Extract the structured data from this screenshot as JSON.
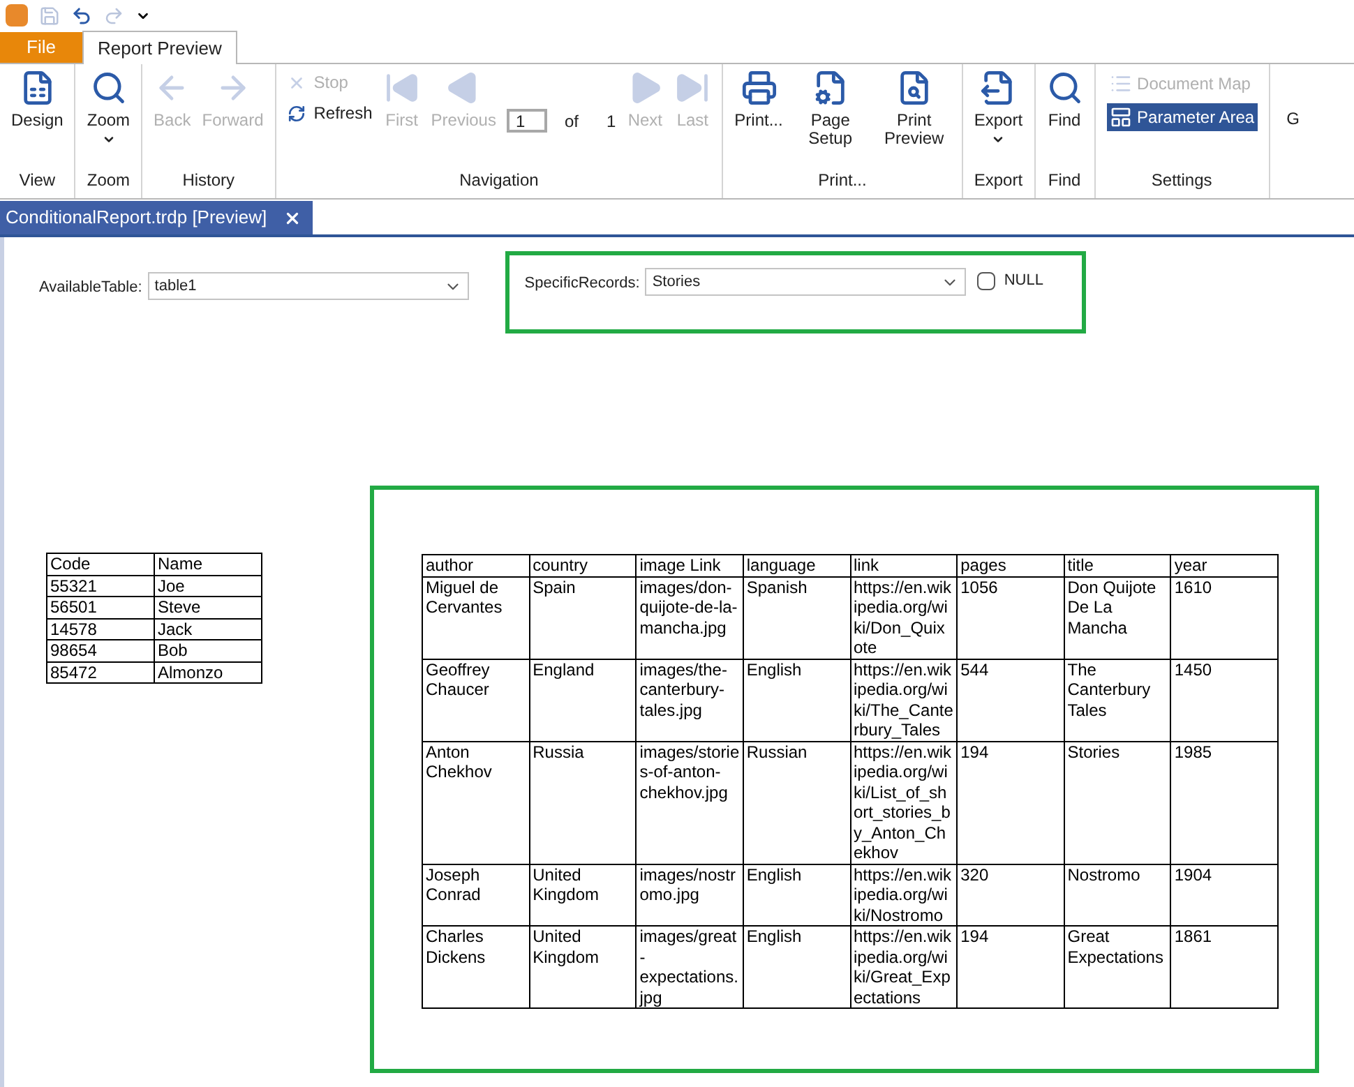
{
  "ribbon_tabs": [
    {
      "label": "File",
      "kind": "file",
      "selected": false
    },
    {
      "label": "Report Preview",
      "kind": "tab",
      "selected": true
    }
  ],
  "ribbon": {
    "groups": [
      {
        "label": "View",
        "items": [
          {
            "kind": "large",
            "label": "Design",
            "disabled": false
          }
        ]
      },
      {
        "label": "Zoom",
        "items": [
          {
            "kind": "large",
            "label": "Zoom",
            "disabled": false,
            "dropdown": true
          }
        ]
      },
      {
        "label": "History",
        "items": [
          {
            "kind": "large",
            "label": "Back",
            "disabled": true
          },
          {
            "kind": "large",
            "label": "Forward",
            "disabled": true
          }
        ]
      },
      {
        "label": "Navigation",
        "items": [
          {
            "kind": "stack",
            "children": [
              {
                "label": "Stop",
                "disabled": true
              },
              {
                "label": "Refresh",
                "disabled": false
              }
            ]
          },
          {
            "kind": "large",
            "label": "First",
            "disabled": true
          },
          {
            "kind": "large",
            "label": "Previous",
            "disabled": true
          },
          {
            "kind": "pager",
            "value": "1",
            "of_label": "of",
            "total": "1"
          },
          {
            "kind": "large",
            "label": "Next",
            "disabled": true
          },
          {
            "kind": "large",
            "label": "Last",
            "disabled": true
          }
        ]
      },
      {
        "label": "Print...",
        "items": [
          {
            "kind": "large",
            "label": "Print...",
            "disabled": false
          },
          {
            "kind": "large",
            "label": "Page Setup",
            "disabled": false
          },
          {
            "kind": "large",
            "label": "Print Preview",
            "disabled": false
          }
        ]
      },
      {
        "label": "Export",
        "items": [
          {
            "kind": "large",
            "label": "Export",
            "disabled": false,
            "dropdown": true
          }
        ]
      },
      {
        "label": "Find",
        "items": [
          {
            "kind": "large",
            "label": "Find",
            "disabled": false
          }
        ]
      },
      {
        "label": "Settings",
        "items": [
          {
            "kind": "toggles",
            "children": [
              {
                "label": "Document Map",
                "disabled": true,
                "selected": false
              },
              {
                "label": "Parameter Area",
                "disabled": false,
                "selected": true
              }
            ]
          }
        ]
      }
    ],
    "cut_label": "G"
  },
  "document_tab": {
    "title": "ConditionalReport.trdp [Preview]"
  },
  "parameters": [
    {
      "label": "AvailableTable:",
      "value": "table1",
      "highlighted": false
    },
    {
      "label": "SpecificRecords:",
      "value": "Stories",
      "highlighted": true,
      "null_checkbox": {
        "label": "NULL",
        "checked": false
      }
    }
  ],
  "code_table": {
    "highlighted": false,
    "columns": [
      "Code",
      "Name"
    ],
    "rows": [
      [
        "55321",
        "Joe"
      ],
      [
        "56501",
        "Steve"
      ],
      [
        "14578",
        "Jack"
      ],
      [
        "98654",
        "Bob"
      ],
      [
        "85472",
        "Almonzo"
      ]
    ]
  },
  "books_table": {
    "highlighted": true,
    "columns": [
      "author",
      "country",
      "image Link",
      "language",
      "link",
      "pages",
      "title",
      "year"
    ],
    "rows": [
      [
        "Miguel de Cervantes",
        "Spain",
        "images/don-quijote-de-la-mancha.jpg",
        "Spanish",
        "https://en.wikipedia.org/wiki/Don_Quixote",
        "1056",
        "Don Quijote De La Mancha",
        "1610"
      ],
      [
        "Geoffrey Chaucer",
        "England",
        "images/the-canterbury-tales.jpg",
        "English",
        "https://en.wikipedia.org/wiki/The_Canterbury_Tales",
        "544",
        "The Canterbury Tales",
        "1450"
      ],
      [
        "Anton Chekhov",
        "Russia",
        "images/stories-of-anton-chekhov.jpg",
        "Russian",
        "https://en.wikipedia.org/wiki/List_of_short_stories_by_Anton_Chekhov",
        "194",
        "Stories",
        "1985"
      ],
      [
        "Joseph Conrad",
        "United Kingdom",
        "images/nostromo.jpg",
        "English",
        "https://en.wikipedia.org/wiki/Nostromo",
        "320",
        "Nostromo",
        "1904"
      ],
      [
        "Charles Dickens",
        "United Kingdom",
        "images/great-expectations.jpg",
        "English",
        "https://en.wikipedia.org/wiki/Great_Expectations",
        "194",
        "Great Expectations",
        "1861"
      ]
    ]
  }
}
